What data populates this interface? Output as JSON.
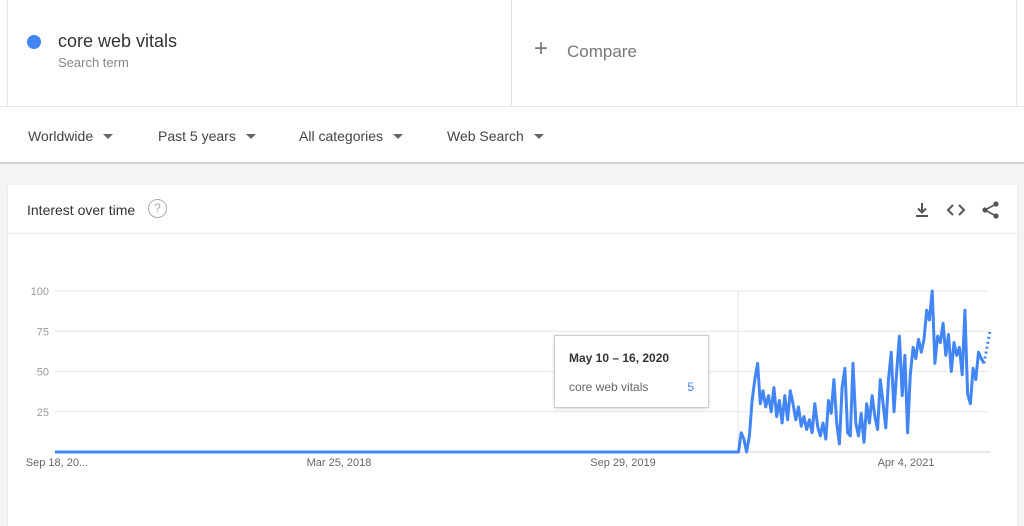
{
  "search_term": {
    "name": "core web vitals",
    "subtitle": "Search term",
    "color": "#4285f4"
  },
  "compare": {
    "label": "Compare",
    "icon": "plus-icon"
  },
  "filters": [
    {
      "label": "Worldwide"
    },
    {
      "label": "Past 5 years"
    },
    {
      "label": "All categories"
    },
    {
      "label": "Web Search"
    }
  ],
  "card": {
    "title": "Interest over time",
    "help_icon": "help-icon",
    "help_glyph": "?",
    "actions": [
      "download-icon",
      "embed-icon",
      "share-icon"
    ]
  },
  "tooltip": {
    "date": "May 10 – 16, 2020",
    "term": "core web vitals",
    "value": "5"
  },
  "chart_data": {
    "type": "line",
    "series": [
      {
        "name": "core web vitals",
        "color": "#4285f4",
        "x_start_week": 0,
        "weeks_total": 240,
        "zero_until_week": 140,
        "values_tail": [
          0,
          0,
          12,
          8,
          0,
          10,
          32,
          45,
          55,
          30,
          38,
          28,
          35,
          25,
          40,
          22,
          32,
          18,
          35,
          20,
          38,
          30,
          20,
          28,
          16,
          22,
          14,
          20,
          12,
          30,
          16,
          10,
          18,
          8,
          32,
          24,
          45,
          18,
          5,
          40,
          52,
          12,
          10,
          55,
          18,
          10,
          24,
          6,
          30,
          18,
          35,
          22,
          14,
          45,
          30,
          15,
          45,
          62,
          25,
          50,
          72,
          35,
          60,
          12,
          48,
          65,
          58,
          70,
          62,
          70,
          88,
          82,
          100,
          55,
          72,
          68,
          80,
          60,
          73,
          50,
          68,
          60,
          65,
          48,
          88,
          36,
          30,
          52,
          45,
          62,
          58,
          55
        ],
        "partial_tail": [
          55,
          75
        ]
      }
    ],
    "x_tick_labels": [
      "Sep 18, 20...",
      "Mar 25, 2018",
      "Sep 29, 2019",
      "Apr 4, 2021"
    ],
    "y_ticks": [
      25,
      50,
      75,
      100
    ],
    "ylim": [
      0,
      100
    ],
    "grid": true
  }
}
